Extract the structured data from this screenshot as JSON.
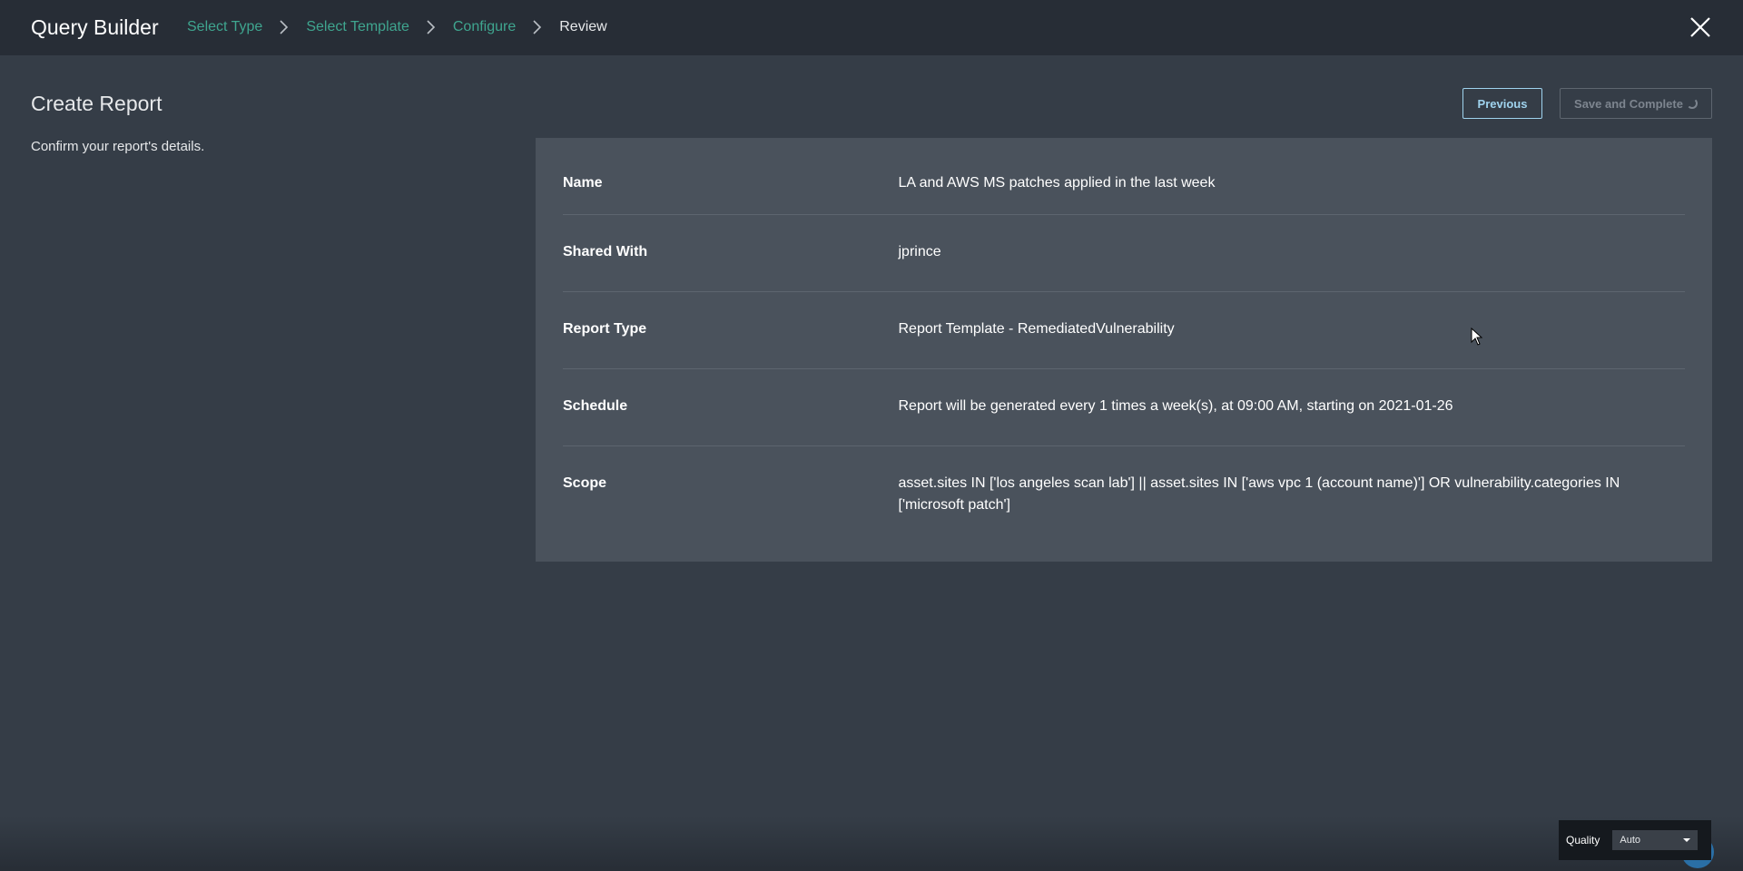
{
  "header": {
    "title": "Query Builder",
    "breadcrumbs": [
      {
        "label": "Select Type"
      },
      {
        "label": "Select Template"
      },
      {
        "label": "Configure"
      },
      {
        "label": "Review"
      }
    ],
    "close_icon": "close-icon"
  },
  "page": {
    "title": "Create Report",
    "subtitle": "Confirm your report's details."
  },
  "actions": {
    "previous_label": "Previous",
    "save_label": "Save and Complete"
  },
  "details": [
    {
      "label": "Name",
      "value": "LA and AWS MS patches applied in the last week"
    },
    {
      "label": "Shared With",
      "value": "jprince"
    },
    {
      "label": "Report Type",
      "value": "Report Template - RemediatedVulnerability"
    },
    {
      "label": "Schedule",
      "value": "Report will be generated every 1 times a week(s), at 09:00 AM, starting on 2021-01-26"
    },
    {
      "label": "Scope",
      "value": "asset.sites IN ['los angeles scan lab'] || asset.sites IN ['aws vpc 1 (account name)'] OR vulnerability.categories IN ['microsoft patch']"
    }
  ],
  "player": {
    "quality_label": "Quality",
    "quality_value": "Auto"
  },
  "colors": {
    "background": "#353d47",
    "header": "#272d36",
    "panel": "#4a525c",
    "link_green": "#3fa58f",
    "accent_blue": "#9fd3ee"
  }
}
